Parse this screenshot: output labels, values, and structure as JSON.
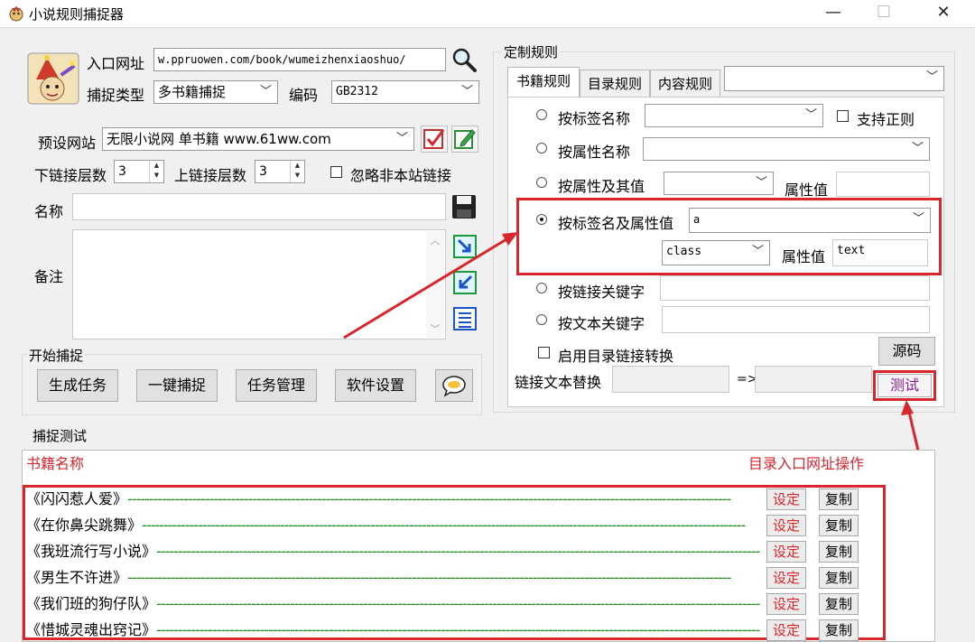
{
  "window": {
    "title": "小说规则捕捉器",
    "minimize": "—",
    "maximize": "☐",
    "close": "✕"
  },
  "left": {
    "entry_url_label": "入口网址",
    "entry_url_value": "w.ppruowen.com/book/wumeizhenxiaoshuo/",
    "capture_type_label": "捕捉类型",
    "capture_type_value": "多书籍捕捉",
    "encoding_label": "编码",
    "encoding_value": "GB2312",
    "preset_site_label": "预设网站",
    "preset_site_value": "无限小说网 单书籍 www.61ww.com",
    "down_link_label": "下链接层数",
    "down_link_value": "3",
    "up_link_label": "上链接层数",
    "up_link_value": "3",
    "ignore_offsite_label": "忽略非本站链接",
    "name_label": "名称",
    "name_value": "",
    "notes_label": "备注",
    "notes_value": "",
    "start_group_title": "开始捕捉",
    "buttons": {
      "generate": "生成任务",
      "one_click": "一键捕捉",
      "task_mgmt": "任务管理",
      "settings": "软件设置"
    }
  },
  "rules": {
    "group_title": "定制规则",
    "tabs": [
      "书籍规则",
      "目录规则",
      "内容规则"
    ],
    "active_tab": 0,
    "tab_combo_value": "",
    "by_tag_name_label": "按标签名称",
    "by_tag_name_value": "",
    "regex_label": "支持正则",
    "by_attr_name_label": "按属性名称",
    "by_attr_name_value": "",
    "by_attr_and_value_label": "按属性及其值",
    "by_attr_and_value_combo": "",
    "attr_value_label": "属性值",
    "attr_value_1": "",
    "by_tag_and_attr_label": "按标签名及属性值",
    "tag_value": "a",
    "attr_combo_value": "class",
    "attr_value_label_2": "属性值",
    "attr_value_2": "text",
    "by_link_keyword_label": "按链接关键字",
    "by_link_keyword_value": "",
    "by_text_keyword_label": "按文本关键字",
    "by_text_keyword_value": "",
    "enable_dir_conversion_label": "启用目录链接转换",
    "source_button": "源码",
    "link_text_replace_label": "链接文本替换",
    "replace_from": "",
    "arrow_text": "=>",
    "replace_to": "",
    "test_button": "测试"
  },
  "test": {
    "group_title": "捕捉测试",
    "header_left": "书籍名称",
    "header_right": "目录入口网址操作",
    "set_label": "设定",
    "copy_label": "复制",
    "rows": [
      {
        "title": "《闪闪惹人爱》"
      },
      {
        "title": "《在你鼻尖跳舞》"
      },
      {
        "title": "《我班流行写小说》"
      },
      {
        "title": "《男生不许进》"
      },
      {
        "title": "《我们班的狗仔队》"
      },
      {
        "title": "《惜城灵魂出窍记》"
      }
    ]
  },
  "colors": {
    "highlight_red": "#d8262d",
    "dash_green": "#1a8a1a",
    "test_purple": "#8b1a9c"
  }
}
